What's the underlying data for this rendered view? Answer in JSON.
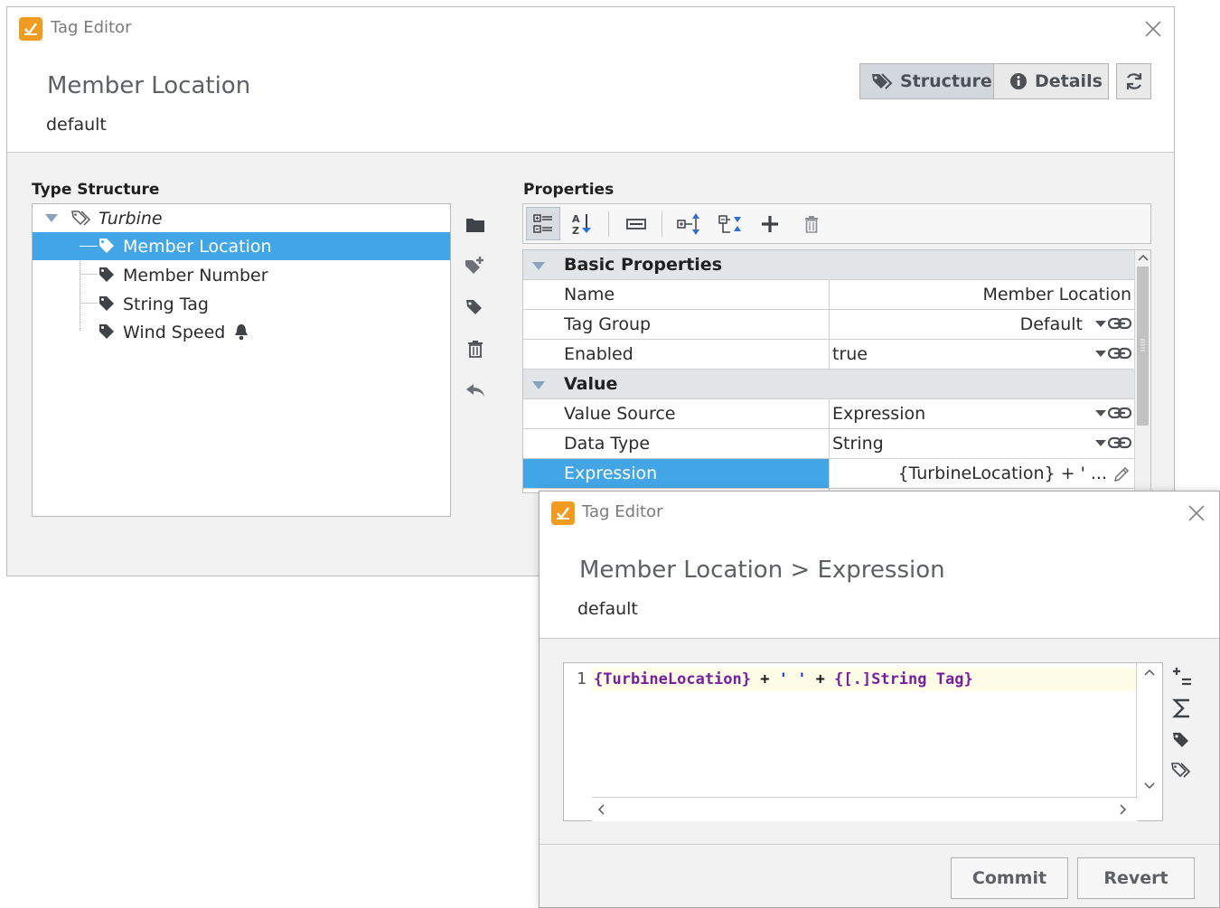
{
  "main_window": {
    "title": "Tag Editor",
    "heading": "Member Location",
    "provider": "default",
    "mode_buttons": {
      "structure": "Structure",
      "details": "Details"
    }
  },
  "type_structure": {
    "label": "Type Structure",
    "root": "Turbine",
    "items": [
      {
        "label": "Member Location",
        "selected": true
      },
      {
        "label": "Member Number"
      },
      {
        "label": "String Tag"
      },
      {
        "label": "Wind Speed",
        "alarm": true
      }
    ]
  },
  "properties": {
    "label": "Properties",
    "categories": [
      {
        "title": "Basic Properties",
        "rows": [
          {
            "name": "Name",
            "value": "Member Location"
          },
          {
            "name": "Tag Group",
            "value": "Default"
          },
          {
            "name": "Enabled",
            "value": "true"
          }
        ]
      },
      {
        "title": "Value",
        "rows": [
          {
            "name": "Value Source",
            "value": "Expression"
          },
          {
            "name": "Data Type",
            "value": "String"
          },
          {
            "name": "Expression",
            "value": "{TurbineLocation} + ' ...",
            "selected": true
          }
        ]
      }
    ]
  },
  "expression_window": {
    "title": "Tag Editor",
    "heading": "Member Location > Expression",
    "provider": "default",
    "line_number": "1",
    "code_tokens": {
      "ref1": "{TurbineLocation}",
      "plus1": " + ",
      "str": "' '",
      "plus2": " + ",
      "ref2": "{[.]String Tag}"
    },
    "commit_label": "Commit",
    "revert_label": "Revert"
  },
  "colors": {
    "selection": "#42a5e6",
    "app_icon": "#f29b21",
    "reference_token": "#7a1ea0",
    "string_token": "#1d3fd6"
  },
  "icons": [
    "tags-icon",
    "info-icon",
    "refresh-icon",
    "close-icon",
    "folder-icon",
    "add-udt-icon",
    "tag-icon",
    "trash-icon",
    "undo-icon",
    "categorized-icon",
    "sort-az-icon",
    "description-icon",
    "expand-all-icon",
    "collapse-all-icon",
    "plus-icon",
    "edit-pencil-icon",
    "bell-icon",
    "sigma-icon",
    "link-icon"
  ]
}
